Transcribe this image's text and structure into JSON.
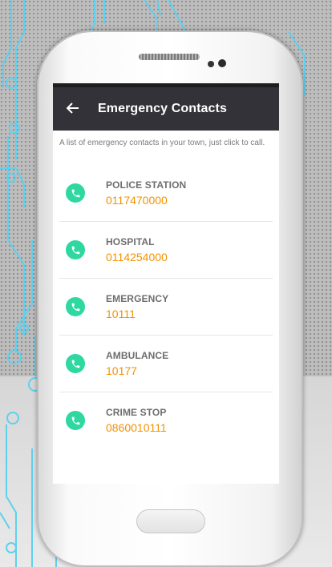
{
  "app": {
    "title": "Emergency Contacts",
    "intro": "A list of emergency contacts in your town, just click to call."
  },
  "contacts": [
    {
      "name": "POLICE STATION",
      "number": "0117470000"
    },
    {
      "name": "HOSPITAL",
      "number": "0114254000"
    },
    {
      "name": "EMERGENCY",
      "number": "10111"
    },
    {
      "name": "AMBULANCE",
      "number": "10177"
    },
    {
      "name": "CRIME STOP",
      "number": "0860010111"
    }
  ],
  "colors": {
    "appbar": "#333238",
    "accent_number": "#f39200",
    "icon_bg": "#2ed8a0"
  },
  "icons": {
    "back": "arrow-left-icon",
    "call": "phone-icon"
  }
}
